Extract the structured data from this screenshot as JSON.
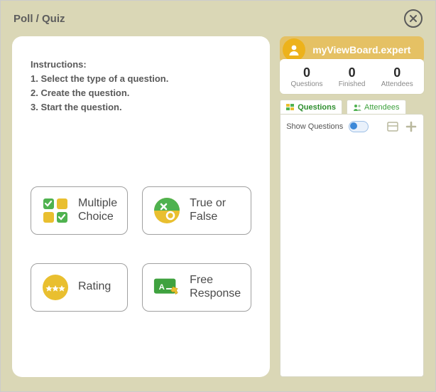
{
  "window": {
    "title": "Poll / Quiz"
  },
  "instructions": {
    "heading": "Instructions:",
    "step1": "1. Select the type of a question.",
    "step2": "2. Create the question.",
    "step3": "3. Start the question."
  },
  "types": {
    "multiple_choice": "Multiple Choice",
    "true_false": "True or False",
    "rating": "Rating",
    "free_response": "Free Response"
  },
  "user": {
    "name": "myViewBoard.expert"
  },
  "stats": {
    "questions": {
      "value": "0",
      "label": "Questions"
    },
    "finished": {
      "value": "0",
      "label": "Finished"
    },
    "attendees": {
      "value": "0",
      "label": "Attendees"
    }
  },
  "tabs": {
    "questions": "Questions",
    "attendees": "Attendees"
  },
  "questions_panel": {
    "show_questions": "Show Questions"
  }
}
